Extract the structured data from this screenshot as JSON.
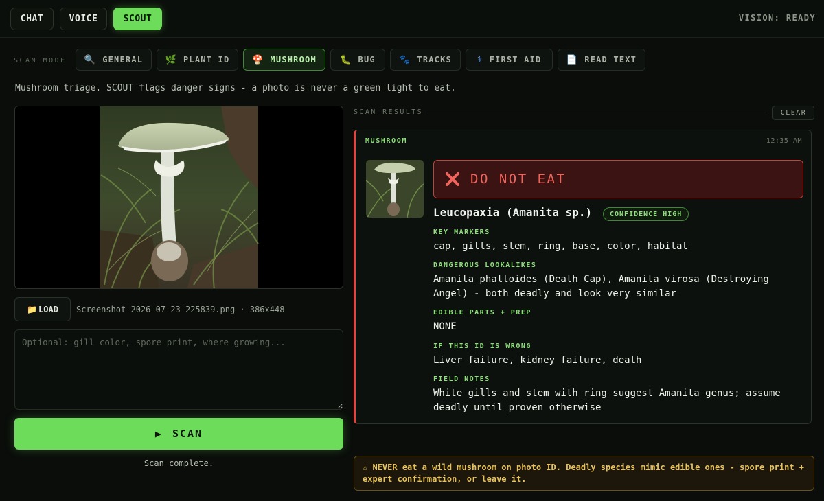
{
  "top_modes": [
    {
      "label": "CHAT",
      "active": false
    },
    {
      "label": "VOICE",
      "active": false
    },
    {
      "label": "SCOUT",
      "active": true
    }
  ],
  "vision_status": "VISION: READY",
  "scan_mode_label": "SCAN MODE",
  "scan_modes": [
    {
      "label": "GENERAL",
      "icon": "🔍",
      "icon_name": "magnifier-icon",
      "active": false
    },
    {
      "label": "PLANT ID",
      "icon": "🌿",
      "icon_name": "herb-icon",
      "active": false
    },
    {
      "label": "MUSHROOM",
      "icon": "🍄",
      "icon_name": "mushroom-icon",
      "active": true
    },
    {
      "label": "BUG",
      "icon": "🐛",
      "icon_name": "bug-icon",
      "active": false
    },
    {
      "label": "TRACKS",
      "icon": "🐾",
      "icon_name": "paw-prints-icon",
      "active": false
    },
    {
      "label": "FIRST AID",
      "icon": "⚕",
      "icon_name": "medical-icon",
      "active": false
    },
    {
      "label": "READ TEXT",
      "icon": "📄",
      "icon_name": "document-icon",
      "active": false
    }
  ],
  "mode_description": "Mushroom triage. SCOUT flags danger signs - a photo is never a green light to eat.",
  "load_button": {
    "icon": "📁",
    "label": "LOAD"
  },
  "file_info": "Screenshot 2026-07-23 225839.png · 386x448",
  "notes_placeholder": "Optional: gill color, spore print, where growing...",
  "scan_button": {
    "icon": "▶",
    "label": "SCAN"
  },
  "scan_status": "Scan complete.",
  "results_label": "SCAN RESULTS",
  "clear_label": "CLEAR",
  "result": {
    "category": "MUSHROOM",
    "time": "12:35 AM",
    "verdict": "DO NOT EAT",
    "verdict_icon": "✕",
    "species": "Leucopaxia (Amanita sp.)",
    "confidence": "CONFIDENCE HIGH",
    "fields": [
      {
        "label": "KEY MARKERS",
        "value": "cap, gills, stem, ring, base, color, habitat"
      },
      {
        "label": "DANGEROUS LOOKALIKES",
        "value": "Amanita phalloides (Death Cap), Amanita virosa (Destroying Angel) - both deadly and look very similar"
      },
      {
        "label": "EDIBLE PARTS + PREP",
        "value": "NONE"
      },
      {
        "label": "IF THIS ID IS WRONG",
        "value": "Liver failure, kidney failure, death"
      },
      {
        "label": "FIELD NOTES",
        "value": "White gills and stem with ring suggest Amanita genus; assume deadly until proven otherwise"
      }
    ]
  },
  "warning": {
    "icon": "⚠",
    "text": "NEVER eat a wild mushroom on photo ID. Deadly species mimic edible ones - spore print + expert confirmation, or leave it."
  },
  "colors": {
    "accent_green": "#6ddc5a",
    "danger_red": "#e0453f",
    "warning_amber": "#e8c25a"
  }
}
